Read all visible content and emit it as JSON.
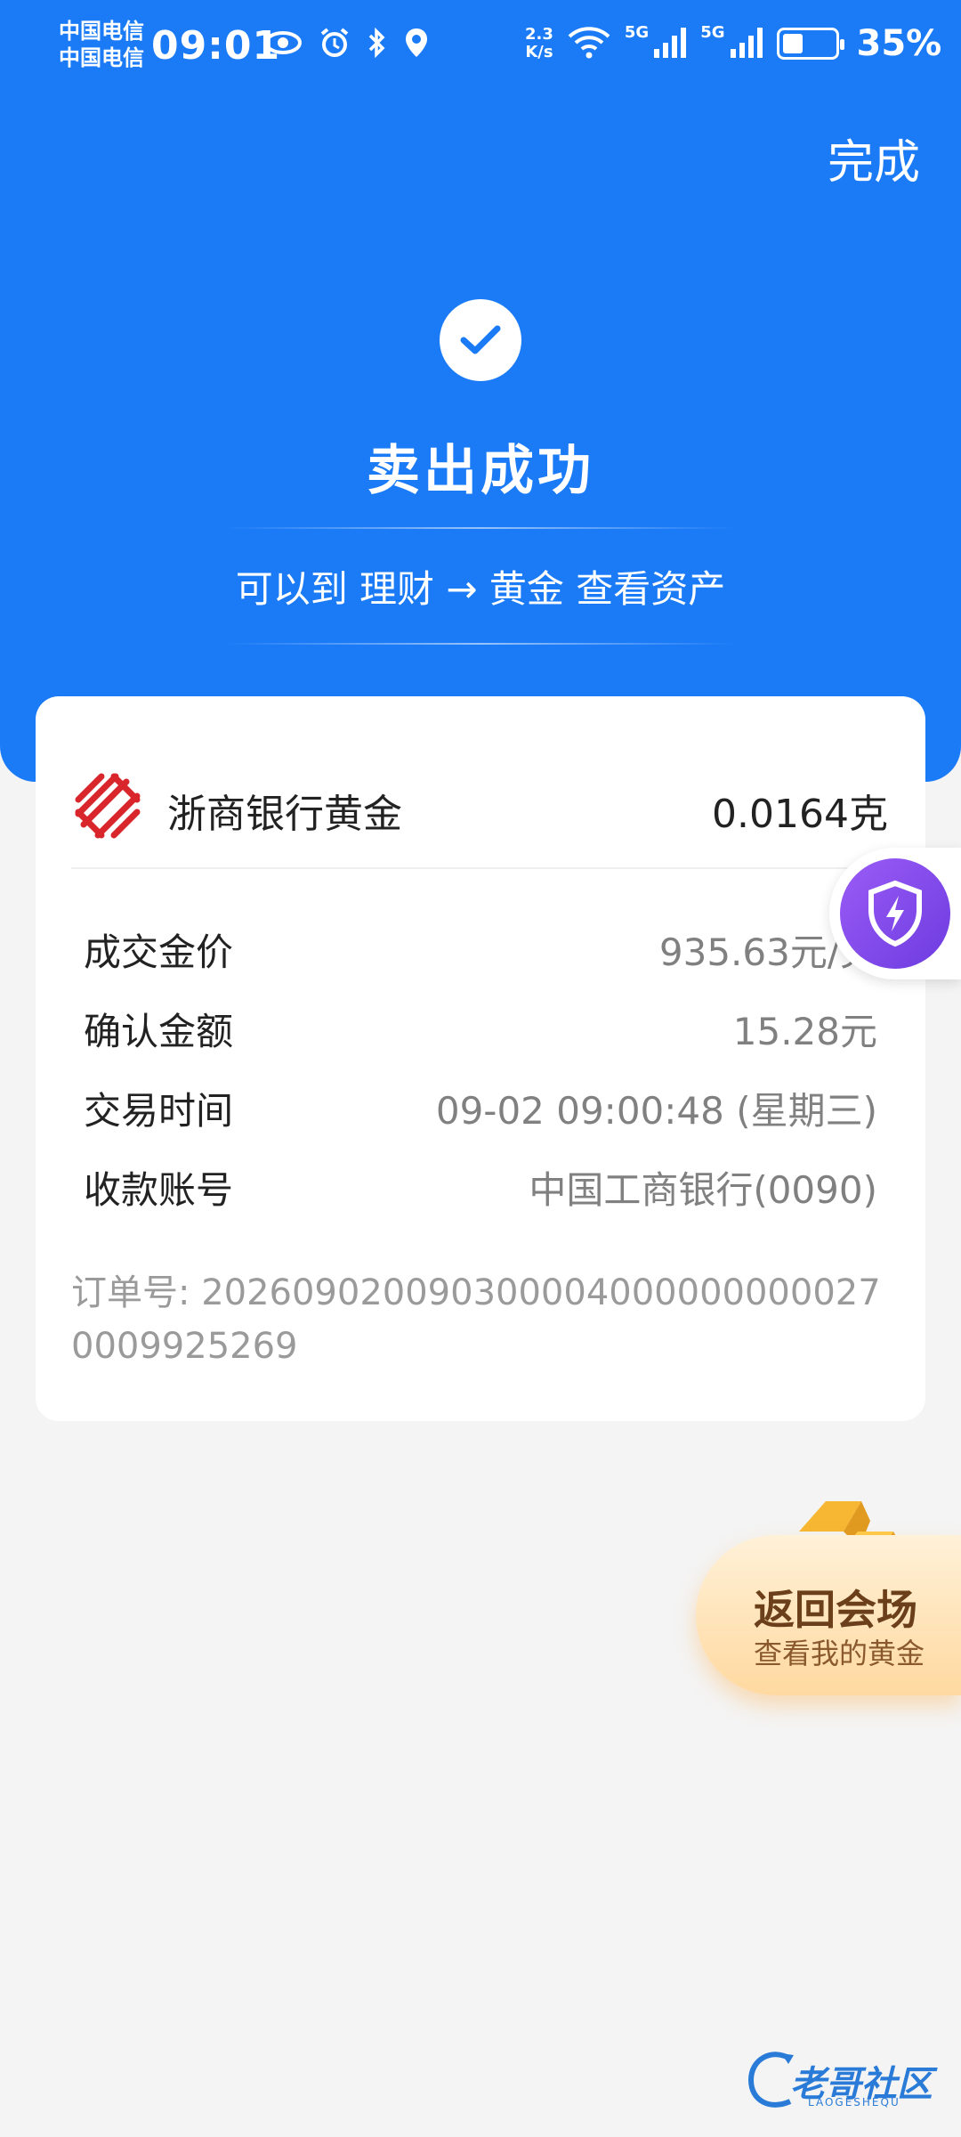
{
  "status_bar": {
    "carrier_1": "中国电信",
    "carrier_2": "中国电信",
    "time": "09:01",
    "net_speed_value": "2.3",
    "net_speed_unit": "K/s",
    "signal_1": "5G",
    "signal_2": "5G",
    "battery": "35%",
    "icons": [
      "eye-icon",
      "alarm-icon",
      "bluetooth-icon",
      "location-icon",
      "wifi-icon",
      "signal-icon",
      "signal-icon",
      "battery-icon"
    ]
  },
  "header": {
    "done_label": "完成",
    "title": "卖出成功",
    "subtitle": "可以到 理财 → 黄金 查看资产"
  },
  "card": {
    "bank_name": "浙商银行黄金",
    "amount": "0.0164克",
    "details": [
      {
        "label": "成交金价",
        "value": "935.63元/克"
      },
      {
        "label": "确认金额",
        "value": "15.28元"
      },
      {
        "label": "交易时间",
        "value": "09-02 09:00:48 (星期三)"
      },
      {
        "label": "收款账号",
        "value": "中国工商银行(0090)"
      }
    ],
    "order_no": "订单号: 20260902009030000400000000002700​09925269"
  },
  "venue_badge": {
    "title": "返回会场",
    "subtitle": "查看我的黄金"
  },
  "watermark": {
    "text": "老哥社区",
    "sub": "LAOGESHEQU"
  },
  "colors": {
    "primary_blue": "#1b7bf7",
    "bank_red": "#d9262c",
    "shield_purple": "#7b45ea"
  }
}
